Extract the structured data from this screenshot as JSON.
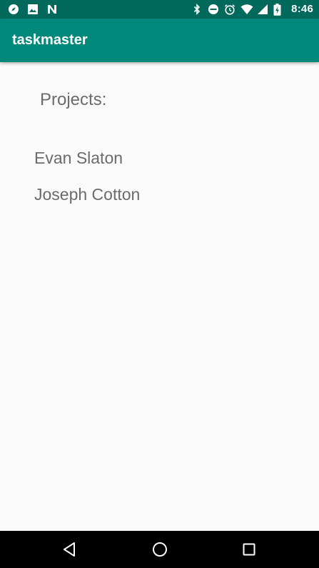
{
  "status_bar": {
    "time": "8:46",
    "left_icons": [
      "compass-icon",
      "image-icon",
      "n-logo-icon"
    ],
    "right_icons": [
      "bluetooth-icon",
      "do-not-disturb-icon",
      "alarm-icon",
      "wifi-icon",
      "signal-icon",
      "battery-charging-icon"
    ]
  },
  "app_bar": {
    "title": "taskmaster",
    "color": "#00897b",
    "status_color": "#00695c"
  },
  "content": {
    "heading": "Projects:",
    "projects": [
      {
        "label": "Evan Slaton"
      },
      {
        "label": "Joseph Cotton"
      }
    ]
  },
  "nav_bar": {
    "buttons": [
      "back-icon",
      "home-icon",
      "recents-icon"
    ]
  }
}
